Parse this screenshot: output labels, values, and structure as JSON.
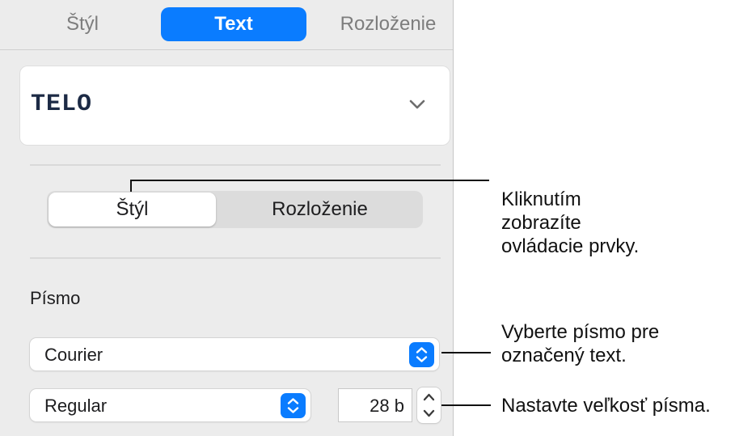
{
  "top_tabs": [
    {
      "label": "Štýl",
      "selected": false
    },
    {
      "label": "Text",
      "selected": true
    },
    {
      "label": "Rozloženie",
      "selected": false
    }
  ],
  "paragraph_style": {
    "name": "TELO",
    "icon": "chevron-down-icon"
  },
  "segmented": [
    {
      "label": "Štýl",
      "selected": true
    },
    {
      "label": "Rozloženie",
      "selected": false
    }
  ],
  "font_section": {
    "label": "Písmo",
    "family": "Courier",
    "typeface": "Regular",
    "size": "28 b"
  },
  "callouts": {
    "c1": [
      "Kliknutím",
      "zobrazíte",
      "ovládacie prvky."
    ],
    "c2": [
      "Vyberte písmo pre",
      "označený text."
    ],
    "c3": [
      "Nastavte veľkosť písma."
    ]
  },
  "colors": {
    "accent": "#0a7cff",
    "panel": "#ececec"
  }
}
